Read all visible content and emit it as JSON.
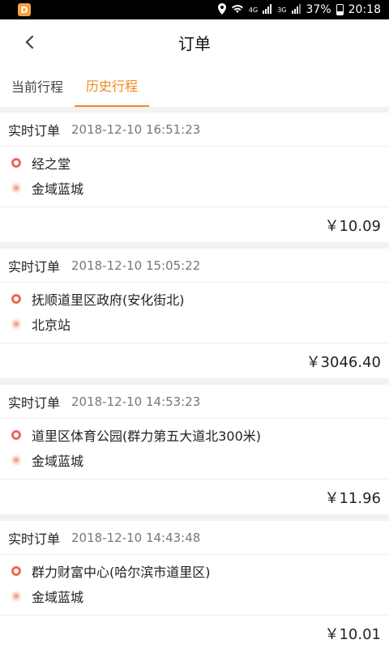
{
  "statusbar": {
    "app_icon_glyph": "D",
    "network": "4G",
    "network2": "3G",
    "battery": "37%",
    "time": "20:18",
    "battery_level": 0.37
  },
  "header": {
    "title": "订单"
  },
  "tabs": [
    {
      "label": "当前行程",
      "active": false
    },
    {
      "label": "历史行程",
      "active": true
    }
  ],
  "orders": [
    {
      "type": "实时订单",
      "time": "2018-12-10 16:51:23",
      "from": "经之堂",
      "to": "金域蓝城",
      "price": "￥10.09"
    },
    {
      "type": "实时订单",
      "time": "2018-12-10 15:05:22",
      "from": "抚顺道里区政府(安化街北)",
      "to": "北京站",
      "price": "￥3046.40"
    },
    {
      "type": "实时订单",
      "time": "2018-12-10 14:53:23",
      "from": "道里区体育公园(群力第五大道北300米)",
      "to": "金域蓝城",
      "price": "￥11.96"
    },
    {
      "type": "实时订单",
      "time": "2018-12-10 14:43:48",
      "from": "群力财富中心(哈尔滨市道里区)",
      "to": "金域蓝城",
      "price": "￥10.01"
    }
  ],
  "colors": {
    "accent": "#f08a1c",
    "start_dot": "#ea6b55",
    "end_dot": "#f2a49a"
  }
}
